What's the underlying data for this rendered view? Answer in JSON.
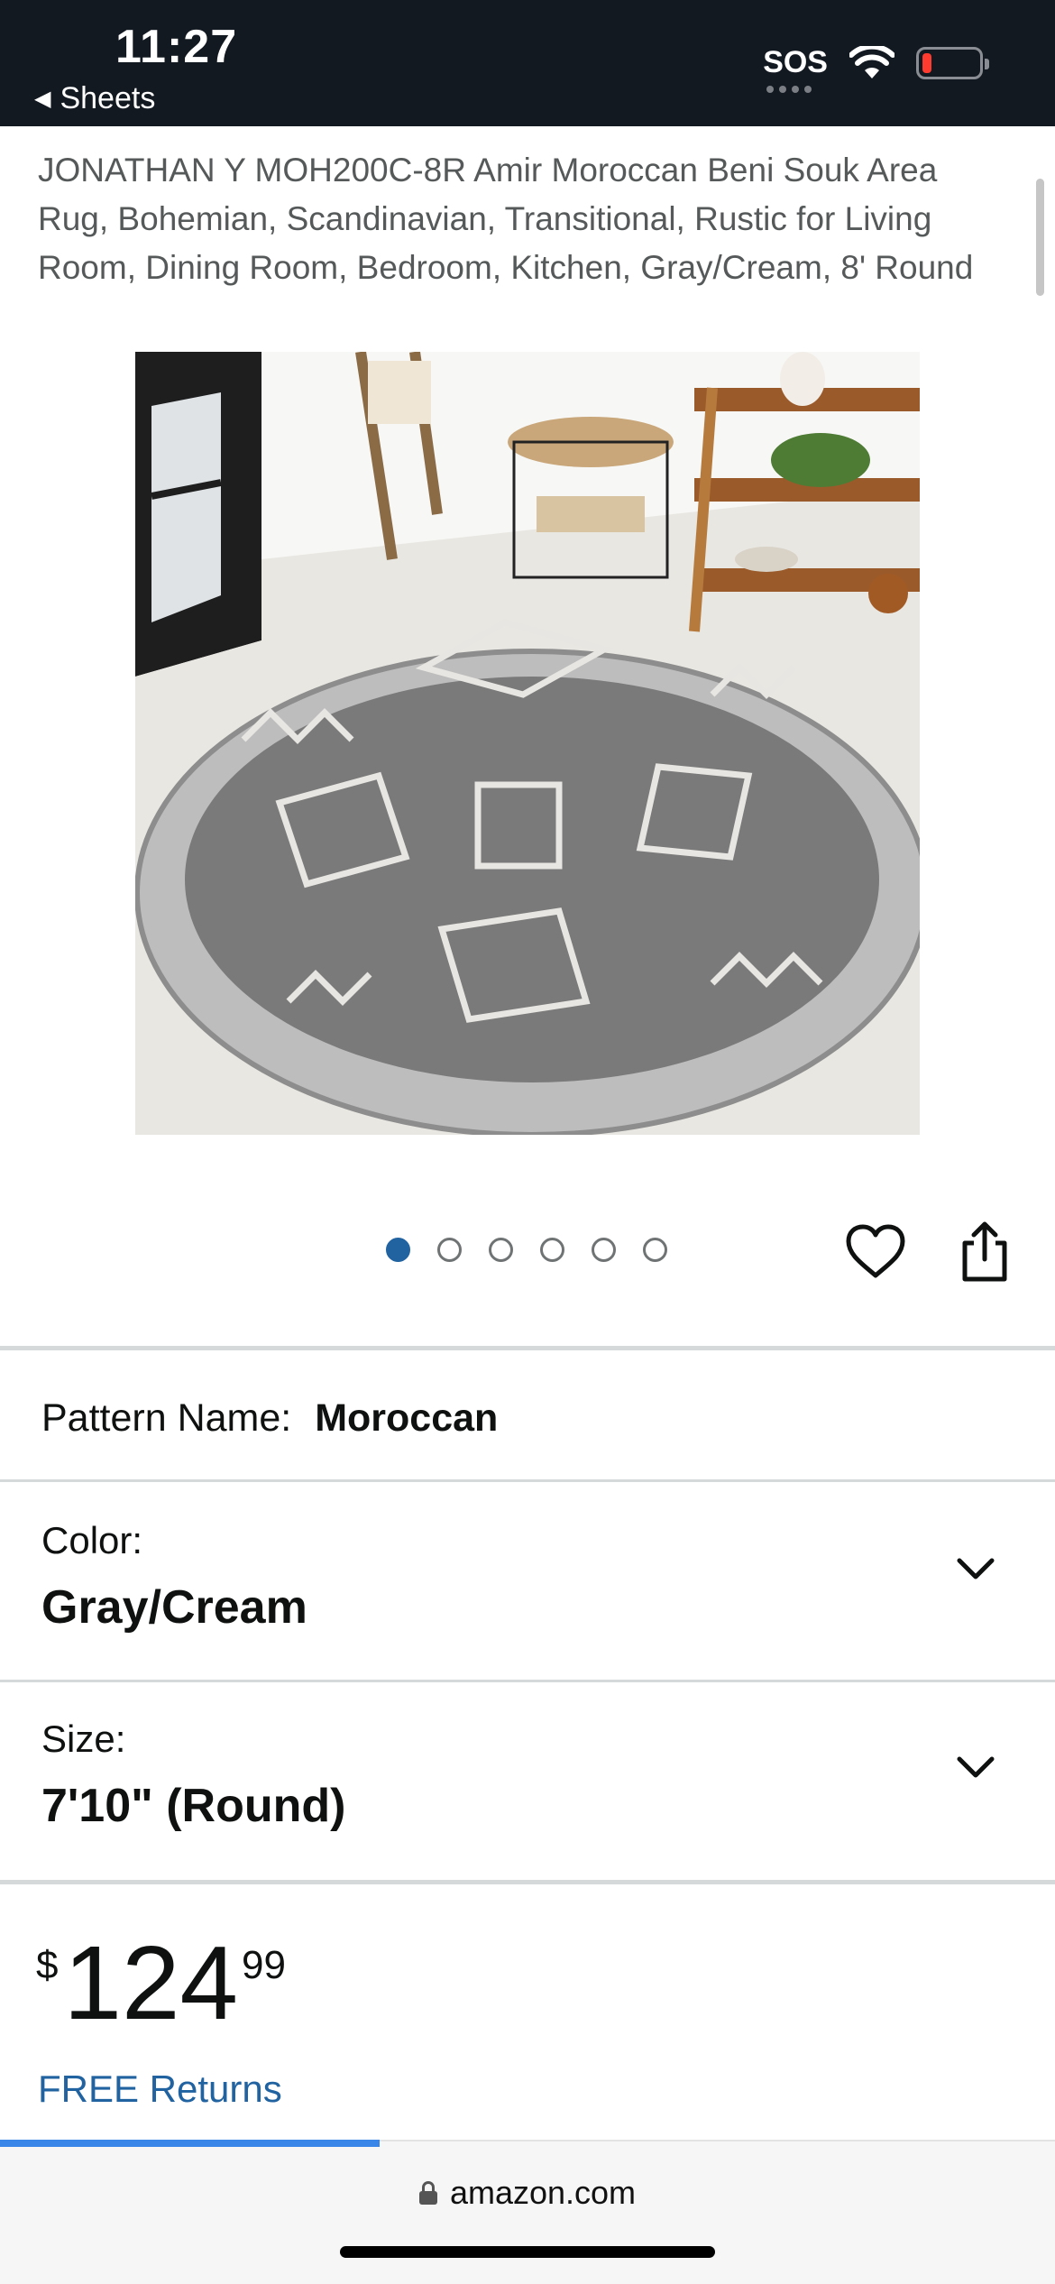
{
  "status_bar": {
    "time": "11:27",
    "back_label": "Sheets",
    "sos": "SOS",
    "battery_color": "#ff3b30",
    "icons": [
      "wifi-icon",
      "battery-icon"
    ]
  },
  "product": {
    "title": "JONATHAN Y MOH200C-8R Amir Moroccan Beni Souk Area Rug, Bohemian, Scandinavian, Transitional, Rustic for Living Room, Dining Room, Bedroom, Kitchen, Gray/Cream, 8' Round",
    "image_description_icon": "product-image",
    "carousel": {
      "count": 6,
      "active_index": 0,
      "active_color": "#2162a1"
    },
    "actions": [
      "heart-icon",
      "share-icon"
    ],
    "pattern": {
      "label": "Pattern Name:",
      "value": "Moroccan"
    },
    "color": {
      "label": "Color:",
      "value": "Gray/Cream"
    },
    "size": {
      "label": "Size:",
      "value": "7'10\" (Round)"
    },
    "price": {
      "symbol": "$",
      "whole": "124",
      "fraction": "99"
    },
    "free_returns": "FREE Returns"
  },
  "browser": {
    "url": "amazon.com",
    "load_progress": 0.36
  }
}
